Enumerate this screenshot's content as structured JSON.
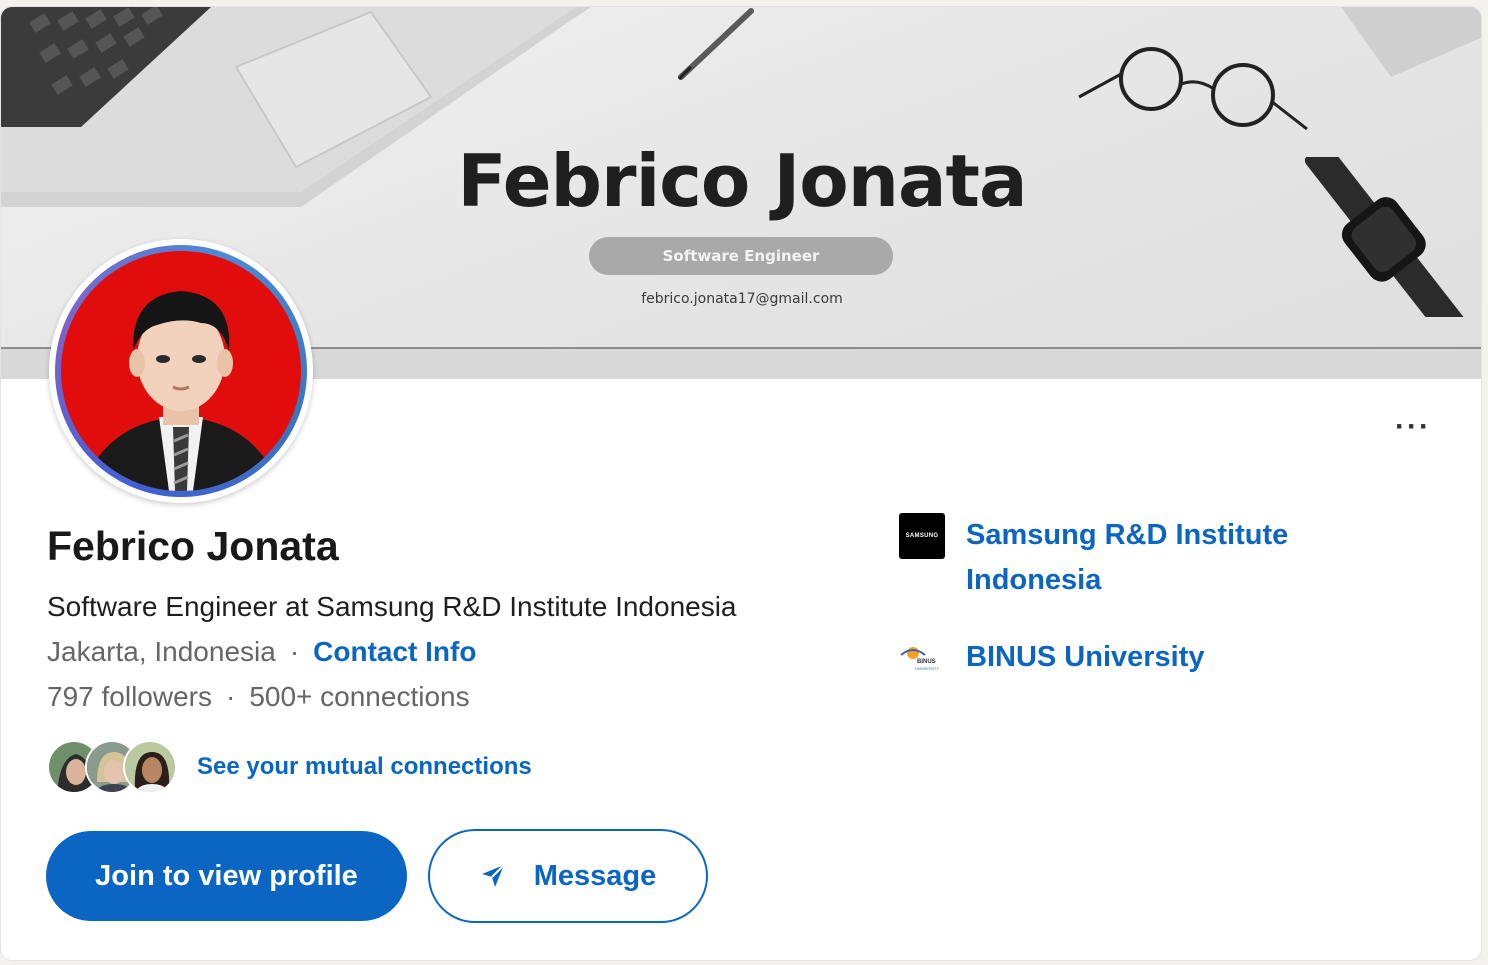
{
  "banner": {
    "title": "Febrico Jonata",
    "pill": "Software Engineer",
    "email": "febrico.jonata17@gmail.com"
  },
  "profile": {
    "name": "Febrico Jonata",
    "headline": "Software Engineer at Samsung R&D Institute Indonesia",
    "location": "Jakarta, Indonesia",
    "separator": "·",
    "contact_label": "Contact Info",
    "followers": "797 followers",
    "connections": "500+ connections"
  },
  "mutual": {
    "label": "See your mutual connections"
  },
  "actions": {
    "join_label": "Join to view profile",
    "message_label": "Message",
    "more_label": "···"
  },
  "orgs": [
    {
      "name": "Samsung R&D Institute Indonesia",
      "logo_text": "SAMSUNG",
      "icon": "samsung-logo"
    },
    {
      "name": "BINUS University",
      "logo_text": "BINUS UNIVERSITY",
      "icon": "binus-logo"
    }
  ],
  "colors": {
    "accent": "#0a66c2",
    "avatar_background": "#e10d0d"
  }
}
